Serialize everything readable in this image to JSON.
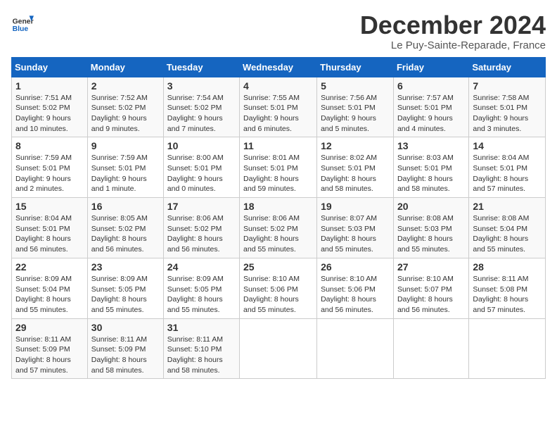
{
  "header": {
    "logo_line1": "General",
    "logo_line2": "Blue",
    "month": "December 2024",
    "location": "Le Puy-Sainte-Reparade, France"
  },
  "columns": [
    "Sunday",
    "Monday",
    "Tuesday",
    "Wednesday",
    "Thursday",
    "Friday",
    "Saturday"
  ],
  "weeks": [
    [
      {
        "day": "1",
        "info": "Sunrise: 7:51 AM\nSunset: 5:02 PM\nDaylight: 9 hours and 10 minutes."
      },
      {
        "day": "2",
        "info": "Sunrise: 7:52 AM\nSunset: 5:02 PM\nDaylight: 9 hours and 9 minutes."
      },
      {
        "day": "3",
        "info": "Sunrise: 7:54 AM\nSunset: 5:02 PM\nDaylight: 9 hours and 7 minutes."
      },
      {
        "day": "4",
        "info": "Sunrise: 7:55 AM\nSunset: 5:01 PM\nDaylight: 9 hours and 6 minutes."
      },
      {
        "day": "5",
        "info": "Sunrise: 7:56 AM\nSunset: 5:01 PM\nDaylight: 9 hours and 5 minutes."
      },
      {
        "day": "6",
        "info": "Sunrise: 7:57 AM\nSunset: 5:01 PM\nDaylight: 9 hours and 4 minutes."
      },
      {
        "day": "7",
        "info": "Sunrise: 7:58 AM\nSunset: 5:01 PM\nDaylight: 9 hours and 3 minutes."
      }
    ],
    [
      {
        "day": "8",
        "info": "Sunrise: 7:59 AM\nSunset: 5:01 PM\nDaylight: 9 hours and 2 minutes."
      },
      {
        "day": "9",
        "info": "Sunrise: 7:59 AM\nSunset: 5:01 PM\nDaylight: 9 hours and 1 minute."
      },
      {
        "day": "10",
        "info": "Sunrise: 8:00 AM\nSunset: 5:01 PM\nDaylight: 9 hours and 0 minutes."
      },
      {
        "day": "11",
        "info": "Sunrise: 8:01 AM\nSunset: 5:01 PM\nDaylight: 8 hours and 59 minutes."
      },
      {
        "day": "12",
        "info": "Sunrise: 8:02 AM\nSunset: 5:01 PM\nDaylight: 8 hours and 58 minutes."
      },
      {
        "day": "13",
        "info": "Sunrise: 8:03 AM\nSunset: 5:01 PM\nDaylight: 8 hours and 58 minutes."
      },
      {
        "day": "14",
        "info": "Sunrise: 8:04 AM\nSunset: 5:01 PM\nDaylight: 8 hours and 57 minutes."
      }
    ],
    [
      {
        "day": "15",
        "info": "Sunrise: 8:04 AM\nSunset: 5:01 PM\nDaylight: 8 hours and 56 minutes."
      },
      {
        "day": "16",
        "info": "Sunrise: 8:05 AM\nSunset: 5:02 PM\nDaylight: 8 hours and 56 minutes."
      },
      {
        "day": "17",
        "info": "Sunrise: 8:06 AM\nSunset: 5:02 PM\nDaylight: 8 hours and 56 minutes."
      },
      {
        "day": "18",
        "info": "Sunrise: 8:06 AM\nSunset: 5:02 PM\nDaylight: 8 hours and 55 minutes."
      },
      {
        "day": "19",
        "info": "Sunrise: 8:07 AM\nSunset: 5:03 PM\nDaylight: 8 hours and 55 minutes."
      },
      {
        "day": "20",
        "info": "Sunrise: 8:08 AM\nSunset: 5:03 PM\nDaylight: 8 hours and 55 minutes."
      },
      {
        "day": "21",
        "info": "Sunrise: 8:08 AM\nSunset: 5:04 PM\nDaylight: 8 hours and 55 minutes."
      }
    ],
    [
      {
        "day": "22",
        "info": "Sunrise: 8:09 AM\nSunset: 5:04 PM\nDaylight: 8 hours and 55 minutes."
      },
      {
        "day": "23",
        "info": "Sunrise: 8:09 AM\nSunset: 5:05 PM\nDaylight: 8 hours and 55 minutes."
      },
      {
        "day": "24",
        "info": "Sunrise: 8:09 AM\nSunset: 5:05 PM\nDaylight: 8 hours and 55 minutes."
      },
      {
        "day": "25",
        "info": "Sunrise: 8:10 AM\nSunset: 5:06 PM\nDaylight: 8 hours and 55 minutes."
      },
      {
        "day": "26",
        "info": "Sunrise: 8:10 AM\nSunset: 5:06 PM\nDaylight: 8 hours and 56 minutes."
      },
      {
        "day": "27",
        "info": "Sunrise: 8:10 AM\nSunset: 5:07 PM\nDaylight: 8 hours and 56 minutes."
      },
      {
        "day": "28",
        "info": "Sunrise: 8:11 AM\nSunset: 5:08 PM\nDaylight: 8 hours and 57 minutes."
      }
    ],
    [
      {
        "day": "29",
        "info": "Sunrise: 8:11 AM\nSunset: 5:09 PM\nDaylight: 8 hours and 57 minutes."
      },
      {
        "day": "30",
        "info": "Sunrise: 8:11 AM\nSunset: 5:09 PM\nDaylight: 8 hours and 58 minutes."
      },
      {
        "day": "31",
        "info": "Sunrise: 8:11 AM\nSunset: 5:10 PM\nDaylight: 8 hours and 58 minutes."
      },
      null,
      null,
      null,
      null
    ]
  ]
}
